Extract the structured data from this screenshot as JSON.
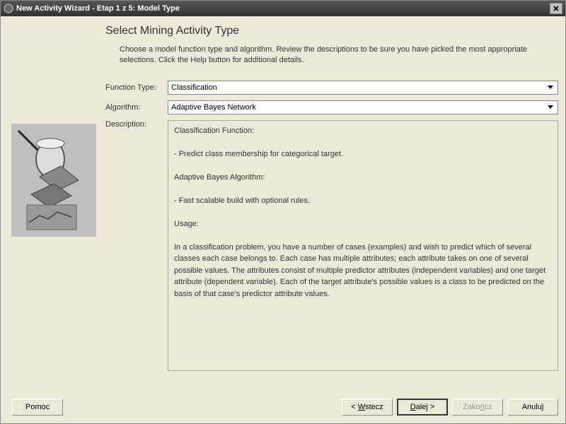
{
  "titlebar": {
    "title": "New Activity Wizard - Etap 1 z 5: Model Type"
  },
  "page": {
    "heading": "Select Mining Activity Type",
    "instructions": "Choose a model function type and algorithm.  Review the descriptions to be sure you have picked the most appropriate selections. Click the Help button for additional details."
  },
  "form": {
    "function_label": "Function Type:",
    "function_value": "Classification",
    "algorithm_label": "Algorithm:",
    "algorithm_value": "Adaptive Bayes Network",
    "description_label": "Description:",
    "description_text": "Classification Function:\n\n  - Predict class membership for categorical target.\n\nAdaptive Bayes Algorithm:\n\n  - Fast scalable build with optional rules.\n\nUsage:\n\nIn a classification problem, you have a number of cases (examples) and wish to predict which of several classes each case belongs to. Each case has multiple attributes; each attribute takes on one of several possible values. The attributes consist of multiple predictor attributes (independent variables) and one target attribute (dependent variable). Each of the target attribute's possible values is a class to be predicted on the basis of that case's predictor attribute values."
  },
  "buttons": {
    "help": "Pomoc",
    "back_prefix": "< ",
    "back_u": "W",
    "back_rest": "stecz",
    "next_u": "D",
    "next_rest": "alej >",
    "finish_prefix": "Zako",
    "finish_u": "ń",
    "finish_rest": "cz",
    "cancel": "Anuluj"
  }
}
